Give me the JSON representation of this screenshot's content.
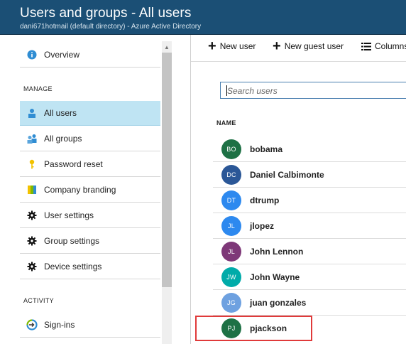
{
  "header": {
    "title": "Users and groups - All users",
    "subtitle": "dani671hotmail (default directory) - Azure Active Directory"
  },
  "nav": {
    "overview": "Overview",
    "manage_heading": "MANAGE",
    "items": [
      {
        "label": "All users",
        "icon": "user-icon",
        "active": true
      },
      {
        "label": "All groups",
        "icon": "group-icon",
        "active": false
      },
      {
        "label": "Password reset",
        "icon": "key-icon",
        "active": false
      },
      {
        "label": "Company branding",
        "icon": "branding-icon",
        "active": false
      },
      {
        "label": "User settings",
        "icon": "gear-icon",
        "active": false
      },
      {
        "label": "Group settings",
        "icon": "gear-icon",
        "active": false
      },
      {
        "label": "Device settings",
        "icon": "gear-icon",
        "active": false
      }
    ],
    "activity_heading": "ACTIVITY",
    "signins": "Sign-ins"
  },
  "toolbar": {
    "new_user": "New user",
    "new_guest_user": "New guest user",
    "columns": "Columns"
  },
  "search": {
    "placeholder": "Search users"
  },
  "table": {
    "column_name": "NAME",
    "users": [
      {
        "initials": "BO",
        "name": "bobama",
        "color": "#1e7145"
      },
      {
        "initials": "DC",
        "name": "Daniel Calbimonte",
        "color": "#2b5797"
      },
      {
        "initials": "DT",
        "name": "dtrump",
        "color": "#2d89ef"
      },
      {
        "initials": "JL",
        "name": "jlopez",
        "color": "#2d89ef"
      },
      {
        "initials": "JL",
        "name": "John Lennon",
        "color": "#7e3878"
      },
      {
        "initials": "JW",
        "name": "John Wayne",
        "color": "#00aba9"
      },
      {
        "initials": "JG",
        "name": "juan gonzales",
        "color": "#6ea1e0"
      },
      {
        "initials": "PJ",
        "name": "pjackson",
        "color": "#1e7145"
      }
    ]
  },
  "colors": {
    "header_bg": "#1b4f75",
    "active_nav_bg": "#bfe4f3",
    "highlight_border": "#e03a3a"
  }
}
